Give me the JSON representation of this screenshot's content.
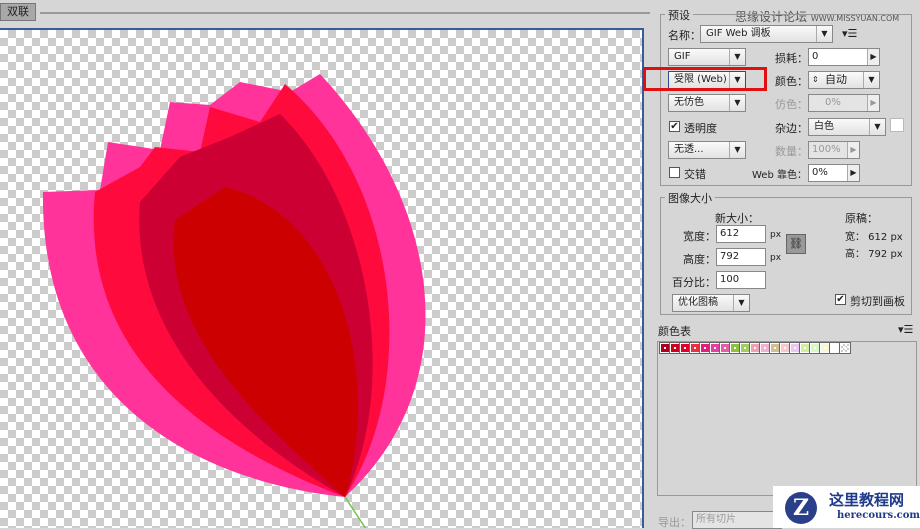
{
  "tab": {
    "label": "双联"
  },
  "watermark": {
    "text": "思缘设计论坛",
    "url": "WWW.MISSYUAN.COM"
  },
  "preset": {
    "legend": "预设",
    "name_label": "名称：",
    "name_value": "GIF Web 调板",
    "format": "GIF",
    "lossy_label": "损耗：",
    "lossy_value": "0",
    "reduction": "受限 (Web)",
    "colors_label": "颜色：",
    "colors_value": "自动",
    "dither_algo": "无仿色",
    "dither_label": "仿色：",
    "dither_value": "0%",
    "transparency_label": "透明度",
    "transparency_checked": true,
    "matte_label": "杂边：",
    "matte_value": "白色",
    "trans_dither": "无透...",
    "amount_label": "数量：",
    "amount_value": "100%",
    "interlaced_label": "交错",
    "interlaced_checked": false,
    "websnap_label": "Web 靠色：",
    "websnap_value": "0%"
  },
  "image_size": {
    "legend": "图像大小",
    "new_size": "新大小：",
    "width_label": "宽度：",
    "width_value": "612",
    "height_label": "高度：",
    "height_value": "792",
    "unit": "px",
    "percent_label": "百分比：",
    "percent_value": "100",
    "quality": "优化图稿",
    "original": "原稿：",
    "orig_w": "宽：  612 px",
    "orig_h": "高：  792 px",
    "clip_label": "剪切到画板",
    "clip_checked": true
  },
  "color_table": {
    "label": "颜色表",
    "swatches": [
      "#b0001e",
      "#d00020",
      "#e0002a",
      "#e83040",
      "#e0207a",
      "#e040a0",
      "#e060a0",
      "#90c040",
      "#a0cc60",
      "#f0a0b0",
      "#f0b0d0",
      "#d0c090",
      "#f8c8d0",
      "#e8c8f0",
      "#d0f0a0",
      "#d8f8c8",
      "#f8f8d8",
      "#ffffff",
      "transparent"
    ]
  },
  "export": {
    "label": "导出：",
    "value": "所有切片"
  },
  "logo": {
    "title": "这里教程网",
    "url": "herecours.com"
  },
  "colors": {
    "pink": "#ff3399",
    "red": "#ff0a3c",
    "crimson": "#cc0033",
    "darkred": "#cc0000",
    "stem": "#7cc04a"
  }
}
